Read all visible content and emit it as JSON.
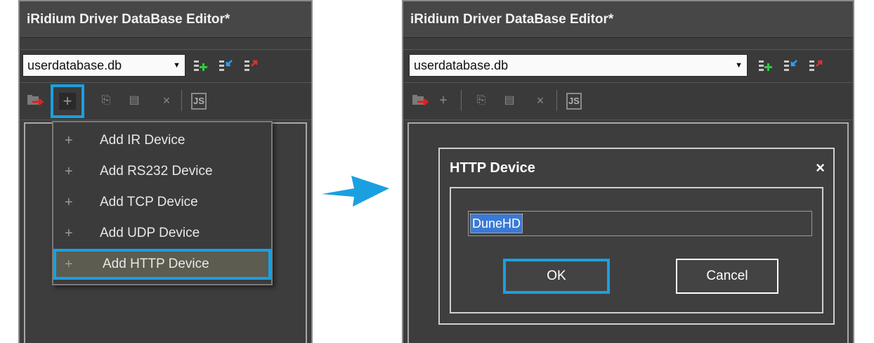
{
  "colors": {
    "accent": "#1aa0e0",
    "panel_bg": "#3d3d3d",
    "menu_active_bg": "#5c5c50",
    "selection": "#3a79d6"
  },
  "left": {
    "title": "iRidium Driver DataBase Editor*",
    "database": "userdatabase.db",
    "menu": [
      {
        "label": "Add IR Device",
        "icon": "plus-icon"
      },
      {
        "label": "Add RS232 Device",
        "icon": "plus-icon"
      },
      {
        "label": "Add TCP Device",
        "icon": "plus-icon"
      },
      {
        "label": "Add UDP Device",
        "icon": "plus-icon"
      },
      {
        "label": "Add HTTP Device",
        "icon": "plus-icon"
      }
    ],
    "toolbar_js": "JS"
  },
  "right": {
    "title": "iRidium Driver DataBase Editor*",
    "database": "userdatabase.db",
    "toolbar_js": "JS",
    "dialog": {
      "title": "HTTP Device",
      "close": "×",
      "input_value": "DuneHD",
      "ok_label": "OK",
      "cancel_label": "Cancel"
    }
  }
}
